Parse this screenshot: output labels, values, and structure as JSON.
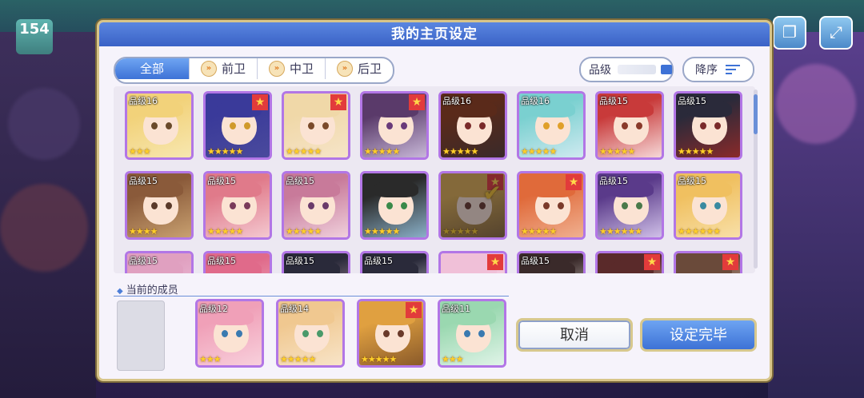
{
  "background": {
    "level_label": "",
    "level_value": "154"
  },
  "dialog": {
    "title": "我的主页设定"
  },
  "tabs": [
    {
      "label": "全部",
      "icon": ""
    },
    {
      "label": "前卫",
      "icon": "chevron-icon"
    },
    {
      "label": "中卫",
      "icon": "chevron-icon"
    },
    {
      "label": "后卫",
      "icon": "chevron-icon"
    }
  ],
  "sort": {
    "grade_label": "品级",
    "order_label": "降序"
  },
  "grid_rows": [
    [
      {
        "grade": "品级16",
        "stars": "★★★",
        "fav": false,
        "hair": "#f2d27a",
        "bg": "#f7e7b0",
        "eye": "#6a4a2a"
      },
      {
        "grade": "",
        "stars": "★★★★★",
        "fav": true,
        "hair": "#3a3a9a",
        "bg": "#4a4a9c",
        "eye": "#d09a2a"
      },
      {
        "grade": "",
        "stars": "★★★★★",
        "fav": true,
        "hair": "#f0d8a8",
        "bg": "#f6e4c8",
        "eye": "#7a4a2a"
      },
      {
        "grade": "",
        "stars": "★★★★★",
        "fav": true,
        "hair": "#5a3a6a",
        "bg": "#c8b8d8",
        "eye": "#6a3a7a"
      },
      {
        "grade": "品级16",
        "stars": "★★★★★",
        "fav": false,
        "hair": "#5a2a1a",
        "bg": "#3a2a2a",
        "eye": "#7a2a2a"
      },
      {
        "grade": "品级16",
        "stars": "★★★★★",
        "fav": false,
        "hair": "#7ad0d0",
        "bg": "#cfeaf0",
        "eye": "#e0a02a"
      },
      {
        "grade": "品级15",
        "stars": "★★★★★",
        "fav": false,
        "hair": "#c83a3a",
        "bg": "#f6d8d8",
        "eye": "#8a3a2a"
      },
      {
        "grade": "品级15",
        "stars": "★★★★★",
        "fav": false,
        "hair": "#2a2a3a",
        "bg": "#8a2a2a",
        "eye": "#7a2a2a"
      }
    ],
    [
      {
        "grade": "品级15",
        "stars": "★★★★",
        "fav": false,
        "hair": "#8a5a3a",
        "bg": "#c8a070",
        "eye": "#5a3a2a"
      },
      {
        "grade": "品级15",
        "stars": "★★★★★",
        "fav": false,
        "hair": "#e07a8a",
        "bg": "#f4c8d0",
        "eye": "#7a3a5a"
      },
      {
        "grade": "品级15",
        "stars": "★★★★★",
        "fav": false,
        "hair": "#c87a9a",
        "bg": "#f0d0dc",
        "eye": "#6a3a6a"
      },
      {
        "grade": "",
        "stars": "★★★★★",
        "fav": false,
        "hair": "#2a2a2a",
        "bg": "#8ab0c8",
        "eye": "#3a8a4a"
      },
      {
        "grade": "",
        "stars": "★★★★★",
        "fav": true,
        "hair": "#e0b050",
        "bg": "#8a6a3a",
        "eye": "#6a3a2a",
        "check": true,
        "dim": true
      },
      {
        "grade": "",
        "stars": "★★★★★",
        "fav": true,
        "hair": "#e06a3a",
        "bg": "#f0b090",
        "eye": "#7a3a2a"
      },
      {
        "grade": "品级15",
        "stars": "★★★★★★",
        "fav": false,
        "hair": "#5a3a8a",
        "bg": "#d0c0e8",
        "eye": "#4a7a4a"
      },
      {
        "grade": "品级15",
        "stars": "★★★★★★",
        "fav": false,
        "hair": "#f0c060",
        "bg": "#f8e0a8",
        "eye": "#3a8aa0"
      }
    ],
    [
      {
        "grade": "品级15",
        "stars": "",
        "fav": false,
        "hair": "#e0a0c0",
        "bg": "#f0c8e0",
        "eye": "#7a3a5a"
      },
      {
        "grade": "品级15",
        "stars": "",
        "fav": false,
        "hair": "#e06a8a",
        "bg": "#f0b8c8",
        "eye": "#7a3a5a"
      },
      {
        "grade": "品级15",
        "stars": "",
        "fav": false,
        "hair": "#2a2a3a",
        "bg": "#c8a8b8",
        "eye": "#5a2a3a"
      },
      {
        "grade": "品级15",
        "stars": "",
        "fav": false,
        "hair": "#2a2a3a",
        "bg": "#e8e8f0",
        "eye": "#3a3a3a"
      },
      {
        "grade": "",
        "stars": "",
        "fav": true,
        "hair": "#f0c0d8",
        "bg": "#f8e0ec",
        "eye": "#7a3a5a"
      },
      {
        "grade": "品级15",
        "stars": "",
        "fav": false,
        "hair": "#3a2a2a",
        "bg": "#f0e8e0",
        "eye": "#3a3a3a"
      },
      {
        "grade": "",
        "stars": "",
        "fav": true,
        "hair": "#5a2a2a",
        "bg": "#f0d8c8",
        "eye": "#5a2a2a"
      },
      {
        "grade": "",
        "stars": "",
        "fav": true,
        "hair": "#6a4a3a",
        "bg": "#e8d0c0",
        "eye": "#5a3a2a"
      }
    ]
  ],
  "current_members": {
    "label": "当前的成员",
    "cards": [
      {
        "grade": "品级12",
        "stars": "★★★",
        "fav": false,
        "hair": "#f0a0b8",
        "bg": "#f8d0dc",
        "eye": "#3a7ab0"
      },
      {
        "grade": "品级14",
        "stars": "★★★★★",
        "fav": false,
        "hair": "#f0c890",
        "bg": "#f8e4c8",
        "eye": "#4a9a6a"
      },
      {
        "grade": "",
        "stars": "★★★★★",
        "fav": true,
        "hair": "#e0a040",
        "bg": "#8a5a2a",
        "eye": "#6a3a2a"
      },
      {
        "grade": "品级11",
        "stars": "★★★",
        "fav": false,
        "hair": "#9ad8b0",
        "bg": "#e0f4e8",
        "eye": "#3a7ab0"
      }
    ]
  },
  "buttons": {
    "cancel": "取消",
    "confirm": "设定完毕"
  }
}
